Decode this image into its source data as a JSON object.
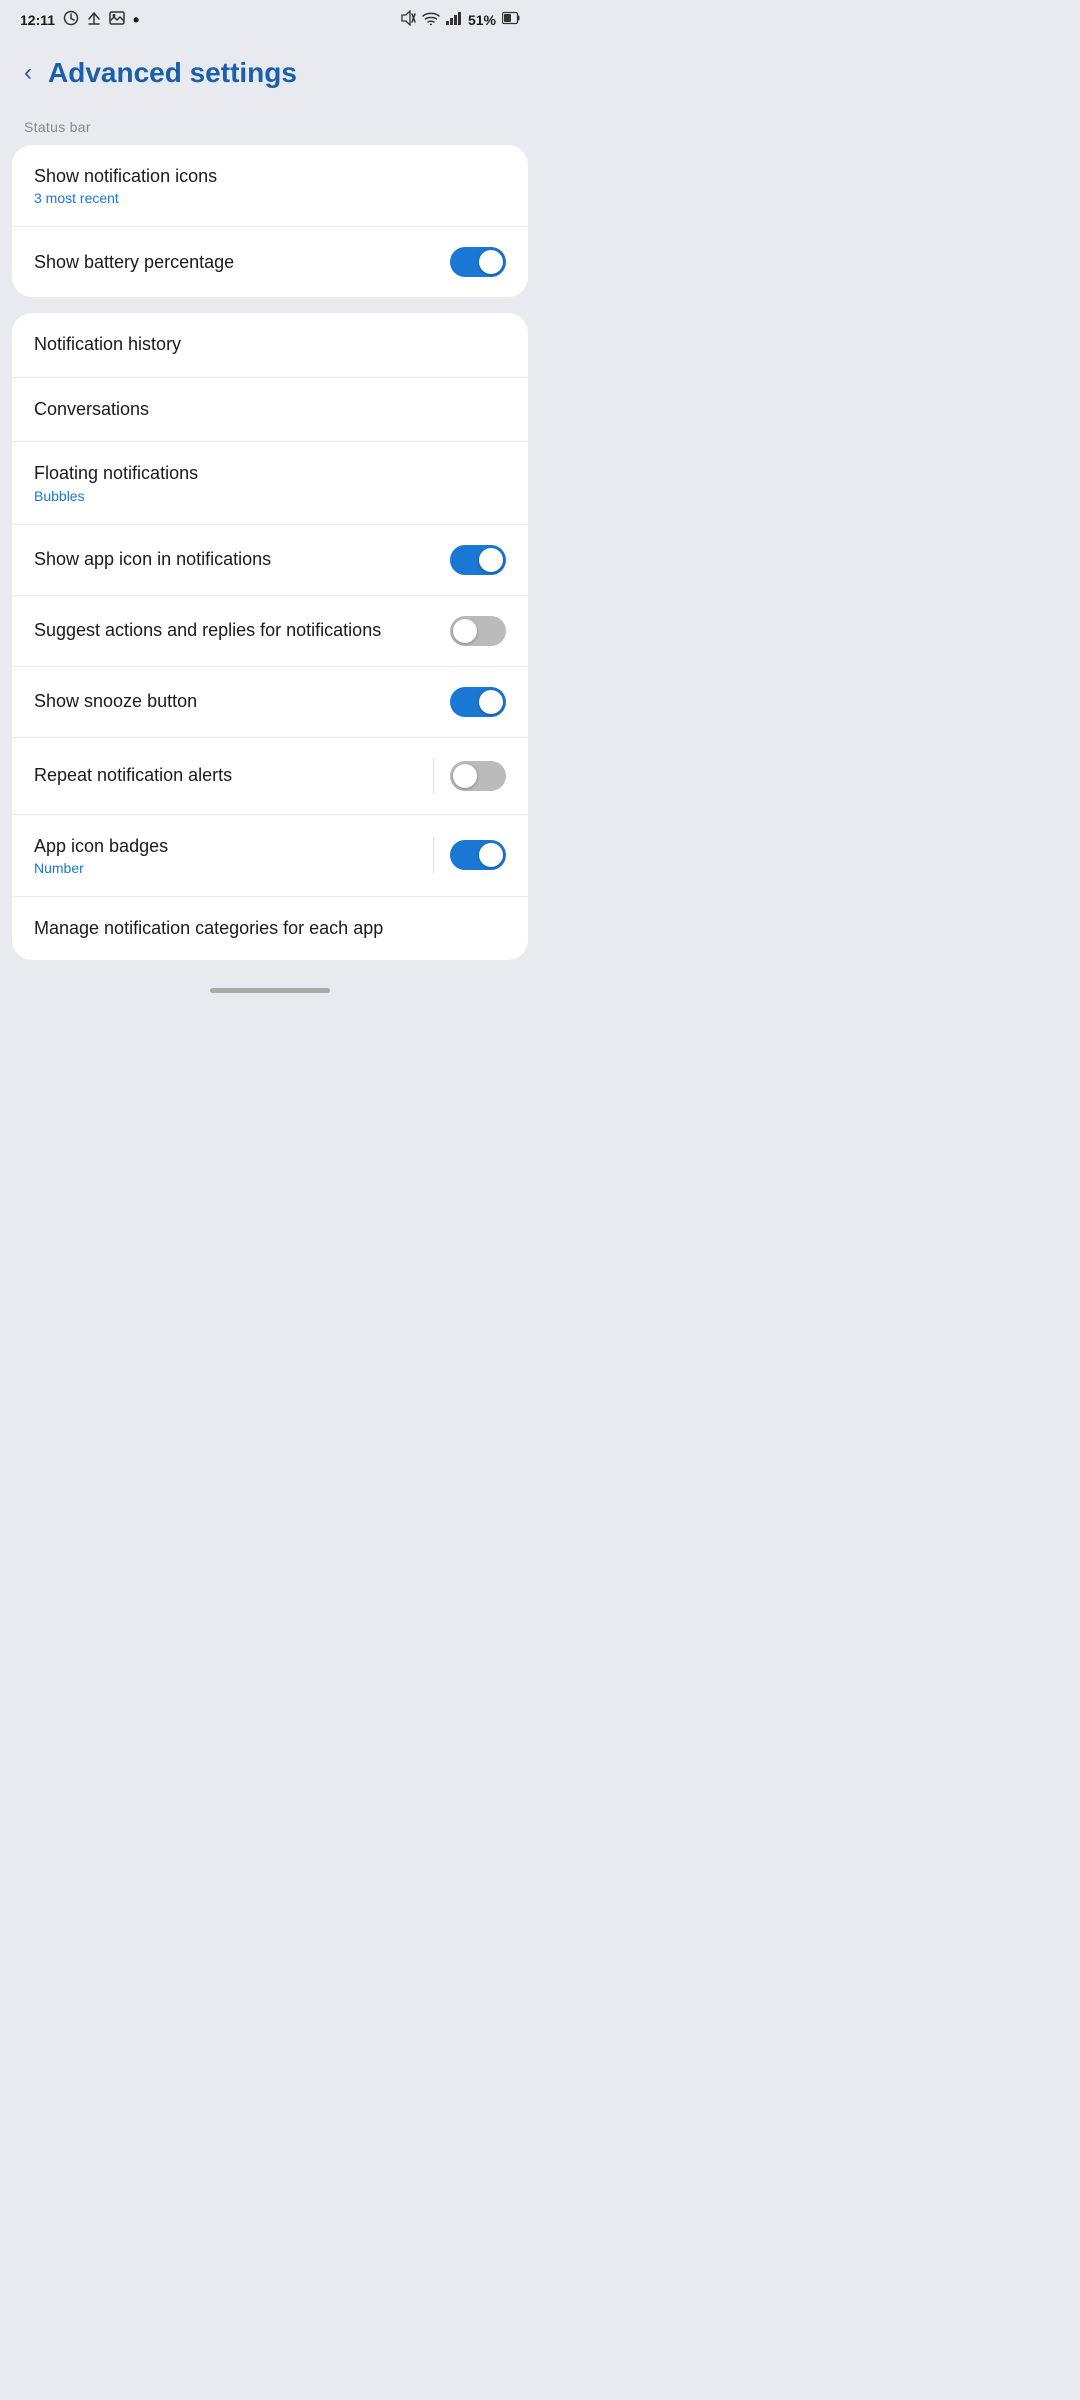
{
  "statusBar": {
    "time": "12:11",
    "battery": "51%",
    "icons_left": [
      "clock",
      "upload",
      "image",
      "dot"
    ],
    "icons_right": [
      "mute",
      "wifi",
      "signal",
      "battery"
    ]
  },
  "header": {
    "backLabel": "‹",
    "title": "Advanced settings"
  },
  "sections": [
    {
      "label": "Status bar",
      "items": [
        {
          "title": "Show notification icons",
          "subtitle": "3 most recent",
          "toggle": null
        },
        {
          "title": "Show battery percentage",
          "subtitle": null,
          "toggle": "on"
        }
      ]
    },
    {
      "label": null,
      "items": [
        {
          "title": "Notification history",
          "subtitle": null,
          "toggle": null
        },
        {
          "title": "Conversations",
          "subtitle": null,
          "toggle": null
        },
        {
          "title": "Floating notifications",
          "subtitle": "Bubbles",
          "toggle": null
        },
        {
          "title": "Show app icon in notifications",
          "subtitle": null,
          "toggle": "on"
        },
        {
          "title": "Suggest actions and replies for notifications",
          "subtitle": null,
          "toggle": "off",
          "pipe": false
        },
        {
          "title": "Show snooze button",
          "subtitle": null,
          "toggle": "on"
        },
        {
          "title": "Repeat notification alerts",
          "subtitle": null,
          "toggle": "off",
          "pipe": true
        },
        {
          "title": "App icon badges",
          "subtitle": "Number",
          "toggle": "on",
          "pipe": true
        },
        {
          "title": "Manage notification categories for each app",
          "subtitle": null,
          "toggle": null,
          "partial": true
        }
      ]
    }
  ]
}
